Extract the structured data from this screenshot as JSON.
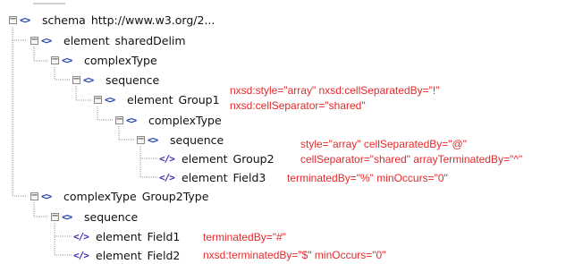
{
  "nodes": [
    {
      "expander": "−",
      "icon": "<>",
      "keyword": "schema",
      "name": "http://www.w3.org/2...",
      "icon_name": "xml-node-icon"
    },
    {
      "expander": "−",
      "icon": "<>",
      "keyword": "element",
      "name": "sharedDelim",
      "icon_name": "xml-node-icon"
    },
    {
      "expander": "−",
      "icon": "<>",
      "keyword": "complexType",
      "name": "",
      "icon_name": "xml-node-icon"
    },
    {
      "expander": "−",
      "icon": "<>",
      "keyword": "sequence",
      "name": "",
      "icon_name": "xml-node-icon"
    },
    {
      "expander": "−",
      "icon": "<>",
      "keyword": "element",
      "name": "Group1",
      "icon_name": "xml-node-icon"
    },
    {
      "expander": "−",
      "icon": "<>",
      "keyword": "complexType",
      "name": "",
      "icon_name": "xml-node-icon"
    },
    {
      "expander": "−",
      "icon": "<>",
      "keyword": "sequence",
      "name": "",
      "icon_name": "xml-node-icon"
    },
    {
      "expander": "",
      "icon": "</>",
      "keyword": "element",
      "name": "Group2",
      "icon_name": "xml-leaf-icon"
    },
    {
      "expander": "",
      "icon": "</>",
      "keyword": "element",
      "name": "Field3",
      "icon_name": "xml-leaf-icon"
    },
    {
      "expander": "−",
      "icon": "<>",
      "keyword": "complexType",
      "name": "Group2Type",
      "icon_name": "xml-node-icon"
    },
    {
      "expander": "−",
      "icon": "<>",
      "keyword": "sequence",
      "name": "",
      "icon_name": "xml-node-icon"
    },
    {
      "expander": "",
      "icon": "</>",
      "keyword": "element",
      "name": "Field1",
      "icon_name": "xml-leaf-icon"
    },
    {
      "expander": "",
      "icon": "</>",
      "keyword": "element",
      "name": "Field2",
      "icon_name": "xml-leaf-icon"
    }
  ],
  "annotations": {
    "group1_line1": "nxsd:style=\"array\" nxsd:cellSeparatedBy=\"!\"",
    "group1_line2": "nxsd:cellSeparator=\"shared\"",
    "group2_line1": "style=\"array\" cellSeparatedBy=\"@\"",
    "group2_line2": "cellSeparator=\"shared\"  arrayTerminatedBy=\"^\"",
    "field3": "terminatedBy=\"%\" minOccurs=\"0\"",
    "field1": "terminatedBy=\"#\"",
    "field2": "nxsd:terminatedBy=\"$\" minOccurs=\"0\""
  },
  "colors": {
    "annotation": "#e6282b",
    "icon": "#1c3fb0",
    "guide": "#9a9a9a"
  }
}
